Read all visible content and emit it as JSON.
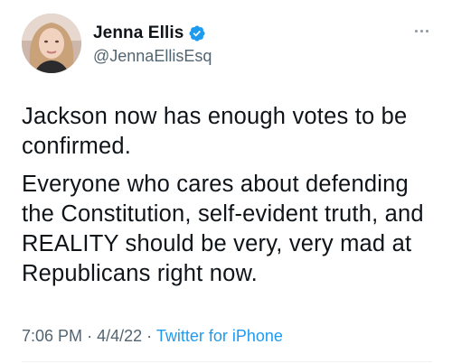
{
  "author": {
    "display_name": "Jenna Ellis",
    "handle": "@JennaEllisEsq",
    "verified": true,
    "avatar_icon": "profile-photo"
  },
  "tweet": {
    "paragraphs": [
      "Jackson now has enough votes to be confirmed.",
      "Everyone who cares about defending the Constitution, self-evident truth, and REALITY should be very, very mad at Republicans right now."
    ],
    "time": "7:06 PM",
    "date": "4/4/22",
    "separator": "·",
    "source": "Twitter for iPhone"
  },
  "colors": {
    "text": "#0f1419",
    "secondary": "#536471",
    "accent": "#1d9bf0"
  },
  "icons": {
    "verified": "verified-badge-icon",
    "more": "more-options-icon"
  }
}
